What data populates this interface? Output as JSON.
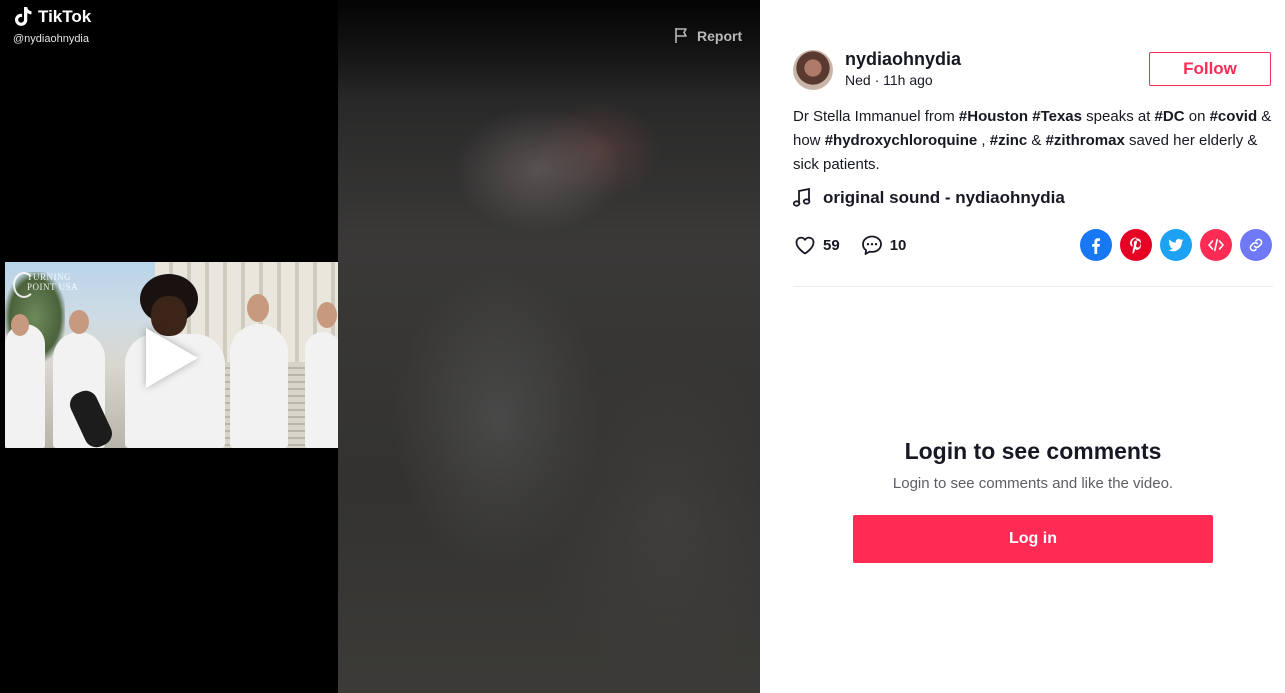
{
  "brand": {
    "name": "TikTok",
    "handle": "@nydiaohnydia"
  },
  "video": {
    "report_label": "Report",
    "thumbnail_watermark": [
      "TURNING",
      "POINT USA"
    ]
  },
  "author": {
    "username": "nydiaohnydia",
    "subline": "Ned · 11h ago",
    "follow_label": "Follow"
  },
  "caption": {
    "parts": [
      {
        "text": "Dr Stella Immanuel from ",
        "tag": false
      },
      {
        "text": "#Houston",
        "tag": true
      },
      {
        "text": " ",
        "tag": false
      },
      {
        "text": "#Texas",
        "tag": true
      },
      {
        "text": " speaks at ",
        "tag": false
      },
      {
        "text": "#DC",
        "tag": true
      },
      {
        "text": " on ",
        "tag": false
      },
      {
        "text": "#covid",
        "tag": true
      },
      {
        "text": " & how ",
        "tag": false
      },
      {
        "text": "#hydroxychloroquine",
        "tag": true
      },
      {
        "text": " , ",
        "tag": false
      },
      {
        "text": "#zinc",
        "tag": true
      },
      {
        "text": " & ",
        "tag": false
      },
      {
        "text": "#zithromax",
        "tag": true
      },
      {
        "text": " saved her elderly & sick patients.",
        "tag": false
      }
    ]
  },
  "sound": {
    "label": "original sound - nydiaohnydia"
  },
  "stats": {
    "likes": "59",
    "comments": "10"
  },
  "share": [
    {
      "name": "facebook",
      "color": "#1877f2"
    },
    {
      "name": "pinterest",
      "color": "#e60023"
    },
    {
      "name": "twitter",
      "color": "#1da1f2"
    },
    {
      "name": "embed",
      "color": "#fe2c55"
    },
    {
      "name": "copy-link",
      "color": "#6f78f5"
    }
  ],
  "comments_gate": {
    "title": "Login to see comments",
    "subtitle": "Login to see comments and like the video.",
    "button_label": "Log in"
  }
}
